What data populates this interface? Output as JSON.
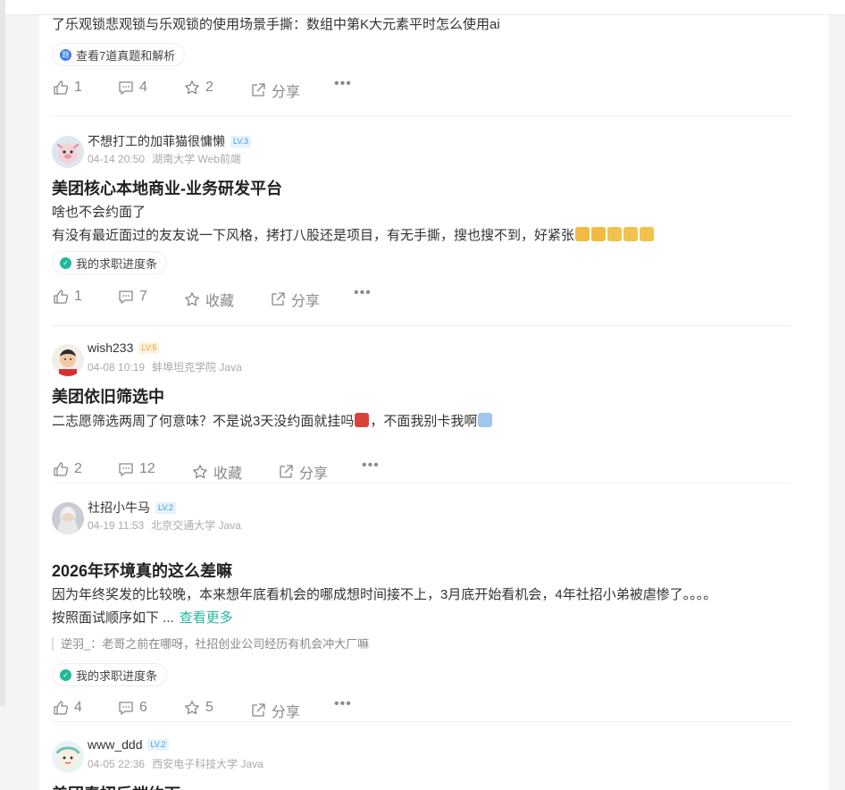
{
  "posts": [
    {
      "body_lines": [
        "了乐观锁悲观锁与乐观锁的使用场景手撕：数组中第K大元素平时怎么使用ai"
      ],
      "tag": {
        "label": "查看7道真题和解析",
        "icon": "question-bank-icon",
        "color": "#3a7bf0"
      },
      "actions": {
        "like": "1",
        "comment": "4",
        "star": "2",
        "share": "分享"
      }
    },
    {
      "author": {
        "name": "不想打工的加菲猫很慵懒",
        "level": "LV.3",
        "date": "04-14 20:50",
        "school": "湖南大学 Web前端"
      },
      "title": "美团核心本地商业-业务研发平台",
      "body_lines": [
        "啥也不会约面了",
        "有没有最近面过的友友说一下风格，拷打八股还是项目，有无手撕，搜也搜不到，好紧张"
      ],
      "tag": {
        "label": "我的求职进度条",
        "icon": "progress-icon",
        "color": "#22b89a"
      },
      "actions": {
        "like": "1",
        "comment": "7",
        "star": "收藏",
        "share": "分享"
      }
    },
    {
      "author": {
        "name": "wish233",
        "level": "LV.5",
        "date": "04-08 10:19",
        "school": "蚌埠坦克学院 Java"
      },
      "title": "美团依旧筛选中",
      "body_lines": [
        "二志愿筛选两周了何意味？不是说3天没约面就挂吗",
        "，不面我别卡我啊"
      ],
      "actions": {
        "like": "2",
        "comment": "12",
        "star": "收藏",
        "share": "分享"
      }
    },
    {
      "author": {
        "name": "社招小牛马",
        "level": "LV.2",
        "date": "04-19 11:53",
        "school": "北京交通大学 Java"
      },
      "title": "2026年环境真的这么差嘛",
      "body_lines": [
        "因为年终奖发的比较晚，本来想年底看机会的哪成想时间接不上，3月底开始看机会，4年社招小弟被虐惨了。。。。",
        "按照面试顺序如下 ..."
      ],
      "more": "查看更多",
      "quote": "逆羽_：老哥之前在哪呀，社招创业公司经历有机会冲大厂嘛",
      "tag": {
        "label": "我的求职进度条",
        "icon": "progress-icon",
        "color": "#22b89a"
      },
      "actions": {
        "like": "4",
        "comment": "6",
        "star": "5",
        "share": "分享"
      }
    },
    {
      "author": {
        "name": "www_ddd",
        "level": "LV.2",
        "date": "04-05 22:36",
        "school": "西安电子科技大学 Java"
      },
      "title": "美团春招后端约面"
    }
  ]
}
